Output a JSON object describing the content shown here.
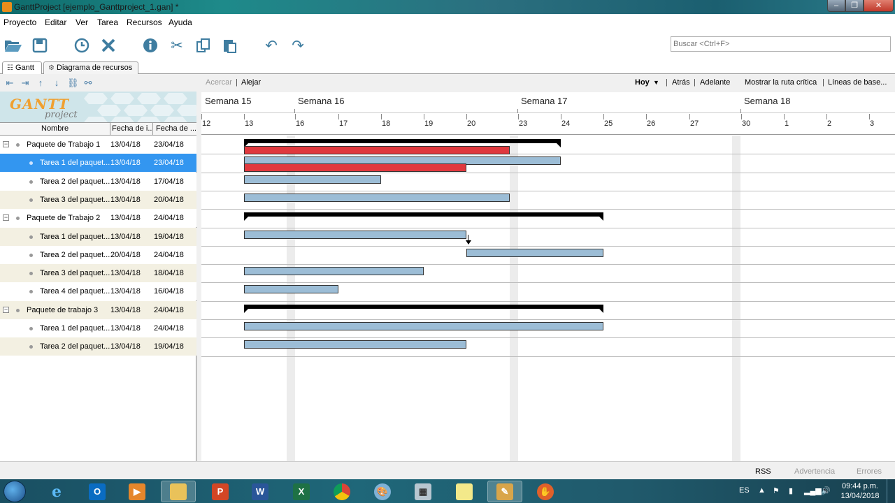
{
  "window": {
    "title": "GanttProject [ejemplo_Ganttproject_1.gan] *"
  },
  "menubar": [
    "Proyecto",
    "Editar",
    "Ver",
    "Tarea",
    "Recursos",
    "Ayuda"
  ],
  "toolbar": {
    "icons": [
      "open-folder-icon",
      "save-icon",
      "clock-icon",
      "delete-icon",
      "info-icon",
      "cut-icon",
      "copy-icon",
      "paste-icon",
      "undo-icon",
      "redo-icon"
    ],
    "search_placeholder": "Buscar <Ctrl+F>"
  },
  "tabs": [
    {
      "label": "Gantt",
      "selected": true
    },
    {
      "label": "Diagrama de recursos",
      "selected": false
    }
  ],
  "logo": {
    "text": "GANTT",
    "sub": "project"
  },
  "table": {
    "columns": [
      "Nombre",
      "Fecha de i...",
      "Fecha de ..."
    ],
    "rows": [
      {
        "name": "Paquete de Trabajo 1",
        "start": "13/04/18",
        "end": "23/04/18",
        "level": 0,
        "expanded": true
      },
      {
        "name": "Tarea 1 del paquet...",
        "start": "13/04/18",
        "end": "23/04/18",
        "level": 1,
        "selected": true
      },
      {
        "name": "Tarea 2 del paquet...",
        "start": "13/04/18",
        "end": "17/04/18",
        "level": 1
      },
      {
        "name": "Tarea 3 del paquet...",
        "start": "13/04/18",
        "end": "20/04/18",
        "level": 1
      },
      {
        "name": "Paquete de Trabajo 2",
        "start": "13/04/18",
        "end": "24/04/18",
        "level": 0,
        "expanded": true
      },
      {
        "name": "Tarea 1 del paquet...",
        "start": "13/04/18",
        "end": "19/04/18",
        "level": 1
      },
      {
        "name": "Tarea 2 del paquet...",
        "start": "20/04/18",
        "end": "24/04/18",
        "level": 1
      },
      {
        "name": "Tarea 3 del paquet...",
        "start": "13/04/18",
        "end": "18/04/18",
        "level": 1
      },
      {
        "name": "Tarea 4 del paquet...",
        "start": "13/04/18",
        "end": "16/04/18",
        "level": 1
      },
      {
        "name": "Paquete de trabajo 3",
        "start": "13/04/18",
        "end": "24/04/18",
        "level": 0,
        "expanded": true
      },
      {
        "name": "Tarea 1 del paquet...",
        "start": "13/04/18",
        "end": "24/04/18",
        "level": 1
      },
      {
        "name": "Tarea 2 del paquet...",
        "start": "13/04/18",
        "end": "19/04/18",
        "level": 1
      }
    ]
  },
  "chart_toolbar": {
    "zoom_in": "Acercar",
    "zoom_out": "Alejar",
    "today": "Hoy",
    "back": "Atrás",
    "forward": "Adelante",
    "critical_path": "Mostrar la ruta crítica",
    "baselines": "Líneas de base..."
  },
  "timeline": {
    "weeks": [
      "Semana 15",
      "Semana 16",
      "Semana 17",
      "Semana 18"
    ],
    "days": [
      "12",
      "13",
      "16",
      "17",
      "18",
      "19",
      "20",
      "23",
      "24",
      "25",
      "26",
      "27",
      "30",
      "1",
      "2",
      "3"
    ]
  },
  "gantt": {
    "bars": [
      {
        "row": 0,
        "kind": "summary",
        "start": "13/04/18",
        "end": "23/04/18"
      },
      {
        "row": 0,
        "kind": "critical",
        "start": "13/04/18",
        "end": "20/04/18"
      },
      {
        "row": 1,
        "kind": "task",
        "start": "13/04/18",
        "end": "23/04/18"
      },
      {
        "row": 1,
        "kind": "critical",
        "start": "13/04/18",
        "end": "19/04/18"
      },
      {
        "row": 2,
        "kind": "task",
        "start": "13/04/18",
        "end": "17/04/18"
      },
      {
        "row": 3,
        "kind": "task",
        "start": "13/04/18",
        "end": "20/04/18"
      },
      {
        "row": 4,
        "kind": "summary",
        "start": "13/04/18",
        "end": "24/04/18"
      },
      {
        "row": 5,
        "kind": "task",
        "start": "13/04/18",
        "end": "19/04/18"
      },
      {
        "row": 6,
        "kind": "task",
        "start": "20/04/18",
        "end": "24/04/18"
      },
      {
        "row": 7,
        "kind": "task",
        "start": "13/04/18",
        "end": "18/04/18"
      },
      {
        "row": 8,
        "kind": "task",
        "start": "13/04/18",
        "end": "16/04/18"
      },
      {
        "row": 9,
        "kind": "summary",
        "start": "13/04/18",
        "end": "24/04/18"
      },
      {
        "row": 10,
        "kind": "task",
        "start": "13/04/18",
        "end": "24/04/18"
      },
      {
        "row": 11,
        "kind": "task",
        "start": "13/04/18",
        "end": "19/04/18"
      }
    ],
    "dependencies": [
      {
        "from_row": 5,
        "to_row": 6
      }
    ],
    "colors": {
      "task": "#9cbdd6",
      "critical": "#e0393e",
      "summary": "#000000",
      "selected_row": "#3396f0"
    }
  },
  "statusbar": [
    "RSS",
    "Advertencia",
    "Errores"
  ],
  "taskbar": {
    "apps": [
      "internet-explorer-icon",
      "outlook-icon",
      "media-player-icon",
      "file-explorer-icon",
      "powerpoint-icon",
      "word-icon",
      "excel-icon",
      "chrome-icon",
      "paint-icon",
      "calculator-icon",
      "sticky-notes-icon",
      "ganttproject-icon",
      "game-icon"
    ],
    "lang": "ES",
    "time": "09:44 p.m.",
    "date": "13/04/2018"
  }
}
